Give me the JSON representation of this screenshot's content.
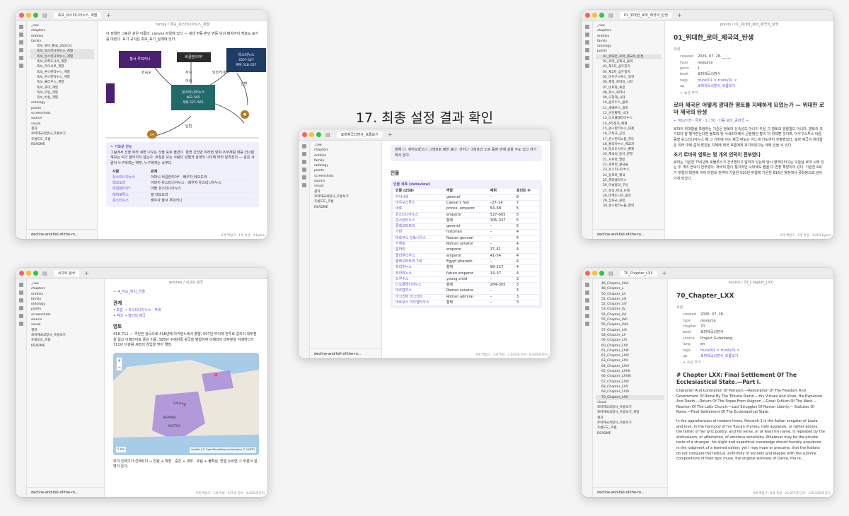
{
  "caption": "17. 최종 설정 결과 확인",
  "vault_name": "decline-and-fall-of-the-ro...",
  "colors": {
    "accent": "#6c4fd6",
    "node_purple": "#4a2070",
    "node_dark": "#2b2b2b",
    "node_navy": "#1f3c66",
    "node_teal": "#226a6a",
    "node_gold": "#b7791f"
  },
  "sidebar": {
    "top_items": [
      "_raw",
      "chapters",
      "entities",
      "family",
      "ontology",
      "points",
      "screenshots",
      "source",
      "visual",
      "결과",
      "로마제국쇠망사_흐름보기",
      "흐름도도_흐름",
      "README"
    ],
    "family_items": [
      "족보_로마_황국_260231",
      "족보_유스티니아누스_계열",
      "족보_유스티니아누스_계열",
      "족보_마케도니아_계열",
      "족보_카이사르_계열",
      "족보_콘스탄티누스_계열",
      "족보_콘스탄티누스_계열",
      "족보_율리우스_계열",
      "족보_로마_계열",
      "족보_부봉_계열",
      "족보_바실_계열"
    ],
    "family_selected": "족보_유스티니아누스_계열",
    "points_items": [
      "01_위대한_로마_제국의_탄생",
      "02_로마_공화국_몰락",
      "03_제1차_삼두정치",
      "04_제2차_삼두정치",
      "05_아우구스투스_즉위",
      "06_제정_로마의_시작",
      "07_네로와_폭정",
      "08_팍스_로마나",
      "09_오현제_시대",
      "10_콤모두스_몰락",
      "11_세베루스_왕조",
      "12_군인황제_시대",
      "13_디오클레티아누스",
      "14_4두정치_체제",
      "15_콘스탄티누스_대제",
      "16_기독교_공인",
      "17_콘스탄티노플_천도",
      "18_율리아누스_배교자",
      "19_테오도시우스_황제",
      "20_제국의_동서_분열",
      "21_서로마_멸망",
      "22_게르만_왕국들",
      "23_유스티니아누스",
      "24_동로마_제국",
      "25_헤라클리우스",
      "26_이슬람의_부상",
      "27_성상_파괴_논쟁",
      "28_마케도니아_왕조",
      "29_십자군_원정",
      "30_콘스탄티노플_함락"
    ],
    "points_selected": "01_위대한_로마_제국의_탄생",
    "chapters_items": [
      "46_Chapter_XLVI",
      "48_Chapter_L",
      "50_Chapter_LII",
      "51_Chapter_LIII",
      "52_Chapter_LIV",
      "53_Chapter_LV",
      "54_Chapter_LVI",
      "55_Chapter_LVII",
      "56_Chapter_LVIII",
      "57_Chapter_LIX",
      "58_Chapter_LX",
      "59_Chapter_LXI",
      "60_Chapter_LXII",
      "61_Chapter_LXIII",
      "62_Chapter_LXIV",
      "63_Chapter_LXV",
      "64_Chapter_LXVI",
      "65_Chapter_LXVII",
      "66_Chapter_LXVIII",
      "67_Chapter_LXIX",
      "68_Chapter_LXX",
      "69_Chapter_LXXI",
      "70_Chapter_LXX"
    ],
    "chapters_selected": "70_Chapter_LXX",
    "bottom_items": [
      "visual",
      "로마제국쇠망사_흐름보기",
      "로마제국쇠망사_흐름보기_세밀",
      "결과",
      "로마제국쇠망사_흐름보기",
      "흐름도도_흐름",
      "README"
    ]
  },
  "win_family": {
    "tab": "족보_유스티니아누스_계열",
    "crumb": "family / 족보_유스티니아누스_계열",
    "intro": "이 정렬한 그림은 같은 이름의 .canvas 파일에 있다 — 세대 변동·혼인 변동·남녀 배치까지 캐보도 표기를 따른다. 표기 규칙은 족보_표기_설계에 있다.",
    "nodes": [
      "황서 루피키나",
      "비길란티아*",
      "유스티누스",
      "유스티니아누스",
      "후안"
    ],
    "node_sub": {
      "justin": "450?–527\n재위 518–527",
      "justinian": "482–565\n재위 527–565"
    },
    "edge_labels": [
      "외숙모",
      "자녀",
      "외조카·양자",
      "남편",
      "남편",
      "아내"
    ],
    "callout_title": "가죠운 한눈",
    "callout_text": "그림에서 선을 따라 세면 나오는 것을 표로 옮겼다. 혈연 간선만 따라면 양자·조부처럼 대를 건너뛴 계보는 여기 끌어지지 않는다. 호칭은 보는 사람의 성별과 상대의 나이에 따라 달라진다 — 같은 사람이 누구에게는 백부, 누구에게는 숙부다.",
    "table_head": [
      "사람",
      "관계"
    ],
    "table_rows": [
      [
        "유스티니아누스",
        "아마니 비길란티아* · 배우자 테오도라"
      ],
      [
        "테오도라",
        "아바지 유스티니아누스 · 배우자 유스티니아누스"
      ],
      [
        "비길란티아*",
        "아들 유스티니아누스"
      ],
      [
        "테미로투스",
        "딸 테오도라"
      ],
      [
        "유스티누스",
        "배우자 황서 루피키나"
      ]
    ],
    "status": "0개 백링크 · 1개 속성 · 4 bytes"
  },
  "win_points": {
    "tab": "01_위대한_로마_제국의_탄생",
    "crumb": "points / 01_위대한_로마_제국의_탄생",
    "title": "01_위대한_로마_제국의_탄생",
    "props_label": "속성",
    "props": [
      [
        "created",
        "2026. 07. 28. __:__"
      ],
      [
        "type",
        "resource"
      ],
      [
        "point",
        "1"
      ],
      [
        "book",
        "로마제국쇠망사"
      ],
      [
        "tags",
        "trunk/01 ×   trunk/01 ×"
      ],
      [
        "up",
        "로마제국쇠망사_흐름보기"
      ]
    ],
    "add_prop": "+ 속성 추가",
    "question": "로마 제국은 어떻게 광대한 영토를 지배하게 되었는가 — 위대한 로마 제국의 탄생",
    "nav": "← 개요/이전 · 목차 · 1 / 30 · 다음 로마_공화국 →",
    "p1": "로마의 위대함을 측정하는 기준은 정복의 신속성도 아니이 두은 그 영토의 광활함도 아니다. 영토의 크기보다 잘 평가받는다면 불모와 탓 사세리아에서 군림했던 황이 더 위대할 것이며, 아우구스투스 대중 동방 유스티니아누스 때 그 가치에 이는 제국 판도는 어느새 인도까지 진출했었다. 로마 제국의 위대함은 여러 대에 걸쳐 방진된 지혜에 제국 흐름에게 유지되었다는 데에 있을 수 있다.",
    "h_early": "초기 로마의 영토는 몇 개의 언덕이 전부였다",
    "p2": "로마는 기원전 753년에 로물루스가 건국했다고 알려져 있는데 당시 영역이라고는 오늘날 로마 시에 있는 두 개의 언덕이 전부였다. 제국의 함이 통치하던 시대에도 팔을 다 연장 확장되어 갔다. 기원전 4세기 무렵의 대관에 이어 마침내 전역이 기원전 510년 무렵에 기원전 616년 왕정에서 공화정으로 넘어가게 되었다.",
    "status": "0개 백링크 · 5개 속성 · 2,003 bytes"
  },
  "win_dataview": {
    "tab": "로마제국쇠망사_흐름보기",
    "crumb": "로마제국쇠망사_흐름보기",
    "note": "말해 다. 쉬어보였으나 그래프로 평한 표다. 선어나 그레프인 노트 등장 만에 실을 수도 있고 저기에서 온다.",
    "section": "인물",
    "dv_title": "인물 목록 (dataview)",
    "columns": [
      "인물 (258)",
      "역할",
      "재위",
      "포인트 수"
    ],
    "rows": [
      [
        "카이사르",
        "general",
        "–",
        "8"
      ],
      [
        "아우구스투스",
        "Caesar's heir",
        "–27–14",
        "7"
      ],
      [
        "네로",
        "prince, emperor",
        "54–68",
        "5"
      ],
      [
        "유스티니아누스",
        "emperor",
        "527–565",
        "5"
      ],
      [
        "콘스탄티누스",
        "황제",
        "306–337",
        "5"
      ],
      [
        "클레오파트라",
        "general",
        "–",
        "5"
      ],
      [
        "기번",
        "historian",
        "–",
        "4"
      ],
      [
        "마르쿠스 안토니우스",
        "Roman general",
        "–",
        "4"
      ],
      [
        "키케로",
        "Roman senator",
        "–",
        "4"
      ],
      [
        "알라릭",
        "emperor",
        "37–41",
        "4"
      ],
      [
        "클라우디우스",
        "emperor",
        "41–54",
        "4"
      ],
      [
        "클레오파트라 7세",
        "Egypt pharaoh",
        "–",
        "4"
      ],
      [
        "프리미누스",
        "황제",
        "98–117",
        "4"
      ],
      [
        "트라야누스",
        "future emperor",
        "14–37",
        "4"
      ],
      [
        "드루수스",
        "young child",
        "–",
        "3"
      ],
      [
        "디오클레티아누스",
        "황제",
        "284–305",
        "3"
      ],
      [
        "마르켈루스",
        "Roman senator",
        "–",
        "3"
      ],
      [
        "아그리파 마그리피",
        "Roman admiral",
        "–",
        "3"
      ],
      [
        "마르쿠스 아우렐리우스",
        "황제",
        "–",
        "3"
      ]
    ],
    "status": "0개 백링크 · 5개 속성 · 1,656개 단어 · 9,445개 문자"
  },
  "win_map": {
    "tab": "서고트 왕국",
    "crumb": "entities / 서고트 왕국",
    "top_link": "— 4_지도_위치_연결",
    "h_rel": "관계",
    "rel": [
      "포함 → 유스티니아누스 · 적대",
      "적대 → 알라릭 제국"
    ],
    "h_land": "영토",
    "land": "418–711 — 격전한 왕국으로 418년에 아키텐느에서 출발, 507년 부이에 전투로 갈리아 대부분을 잃고 이베리아로 중심 이동. 585년 수에비족 왕국을 병합하여 이베리아 대부분을 지배하다가 711년 이슬람 세력의 침입을 받아 멸망.",
    "map_labels": [
      "GALLIA",
      "HISPANIA",
      "BAETICA"
    ],
    "map_scale": "5 km",
    "map_credit": "Leaflet | © OpenStreetMap contributors © CARTO",
    "footer": "위의 인해기가 선례되다 → 전왕 + 확장 · 중간 + 대부 · 흐림 + 불확실. 연결 누르면 그 부분이 설명이 뜬다.",
    "status": "0개 백링크 · 1개 속성 · 475개 단어 · 2,625개 문자"
  },
  "win_chapter": {
    "tab": "70_Chapter_LXX",
    "crumb": "source / 70_Chapter_LXX",
    "title": "70_Chapter_LXX",
    "props_label": "속성",
    "props": [
      [
        "created",
        "2026. 07. 28."
      ],
      [
        "type",
        "resource"
      ],
      [
        "chapter",
        "70"
      ],
      [
        "book",
        "로마제국쇠망사"
      ],
      [
        "source",
        "Project Gutenberg"
      ],
      [
        "lang",
        "en"
      ],
      [
        "tags",
        "trunk/01 ×   trunk/01 ×"
      ],
      [
        "up",
        "로마제국쇠망사_흐름보기"
      ]
    ],
    "add_prop": "+ 속성 추가",
    "heading": "# Chapter LXX: Final Settlement Of The Ecclesiastical State.—Part I.",
    "summary": "Character And Coronation Of Petrarch.—Restoration Of The Freedom And Government Of Rome By The Tribune Rienzi.—His Virtues And Vices, His Expulsion And Death.—Return Of The Popes From Avignon.—Great Schism Of The West.—Reunion Of The Latin Church.—Last Struggles Of Roman Liberty.— Statutes Of Rome.—Final Settlement Of The Ecclesiastical State.",
    "para": "In the apprehension of modern times, Petrarch 1 is the Italian songster of Laura and love. In the harmony of his Tuscan rhymes, Italy applauds, or rather adores, the father of her lyric poetry; and his verse, or at least his name, is repeated by the enthusiasm, or affectation, of amorous sensibility. Whatever may be the private taste of a stranger, his slight and superficial knowledge should humbly acquiesce in the judgment of a learned nation; yet I may hope or presume, that the Italians do not compare the tedious uniformity of sonnets and elegies with the sublime compositions of their epic muse, the original wildness of Dante, the re...",
    "status": "0개 백링크 · 8개 속성 · 22,875개 단어 · 135,529개 문자"
  }
}
